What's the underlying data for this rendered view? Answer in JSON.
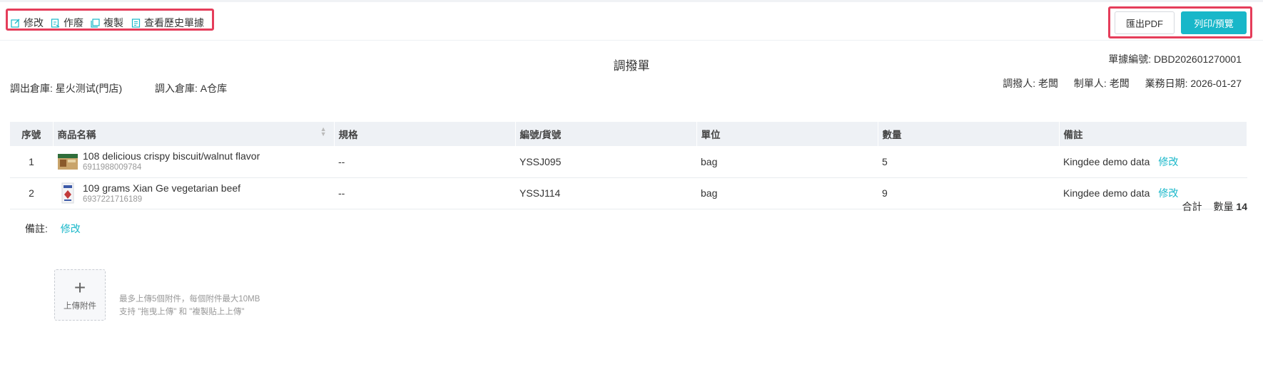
{
  "toolbar": {
    "edit_label": "修改",
    "void_label": "作廢",
    "copy_label": "複製",
    "history_label": "查看歷史單據",
    "export_pdf_label": "匯出PDF",
    "print_label": "列印/預覽"
  },
  "doc": {
    "title": "調撥單",
    "number_label": "單據編號:",
    "number": "DBD202601270001",
    "out_wh_label": "調出倉庫:",
    "out_wh": "星火测试(門店)",
    "in_wh_label": "調入倉庫:",
    "in_wh": "A仓库",
    "transferor_label": "調撥人:",
    "transferor": "老闆",
    "maker_label": "制單人:",
    "maker": "老闆",
    "date_label": "業務日期:",
    "date": "2026-01-27"
  },
  "table": {
    "headers": [
      "序號",
      "商品名稱",
      "規格",
      "編號/貨號",
      "單位",
      "數量",
      "備註"
    ],
    "rows": [
      {
        "index": "1",
        "name": "108 delicious crispy biscuit/walnut flavor",
        "barcode": "6911988009784",
        "spec": "--",
        "code": "YSSJ095",
        "unit": "bag",
        "qty": "5",
        "remark": "Kingdee demo data",
        "edit": "修改"
      },
      {
        "index": "2",
        "name": "109 grams Xian Ge vegetarian beef",
        "barcode": "6937221716189",
        "spec": "--",
        "code": "YSSJ114",
        "unit": "bag",
        "qty": "9",
        "remark": "Kingdee demo data",
        "edit": "修改"
      }
    ]
  },
  "summary": {
    "total_label": "合計",
    "qty_label": "數量",
    "qty_total": "14"
  },
  "remarks": {
    "label": "備註:",
    "edit": "修改"
  },
  "upload": {
    "label": "上傳附件",
    "hint1": "最多上傳5個附件，每個附件最大10MB",
    "hint2": "支持 \"拖曳上傳\" 和 \"複製貼上上傳\""
  },
  "colors": {
    "accent": "#18b7c9",
    "highlight": "#e53d5a"
  }
}
